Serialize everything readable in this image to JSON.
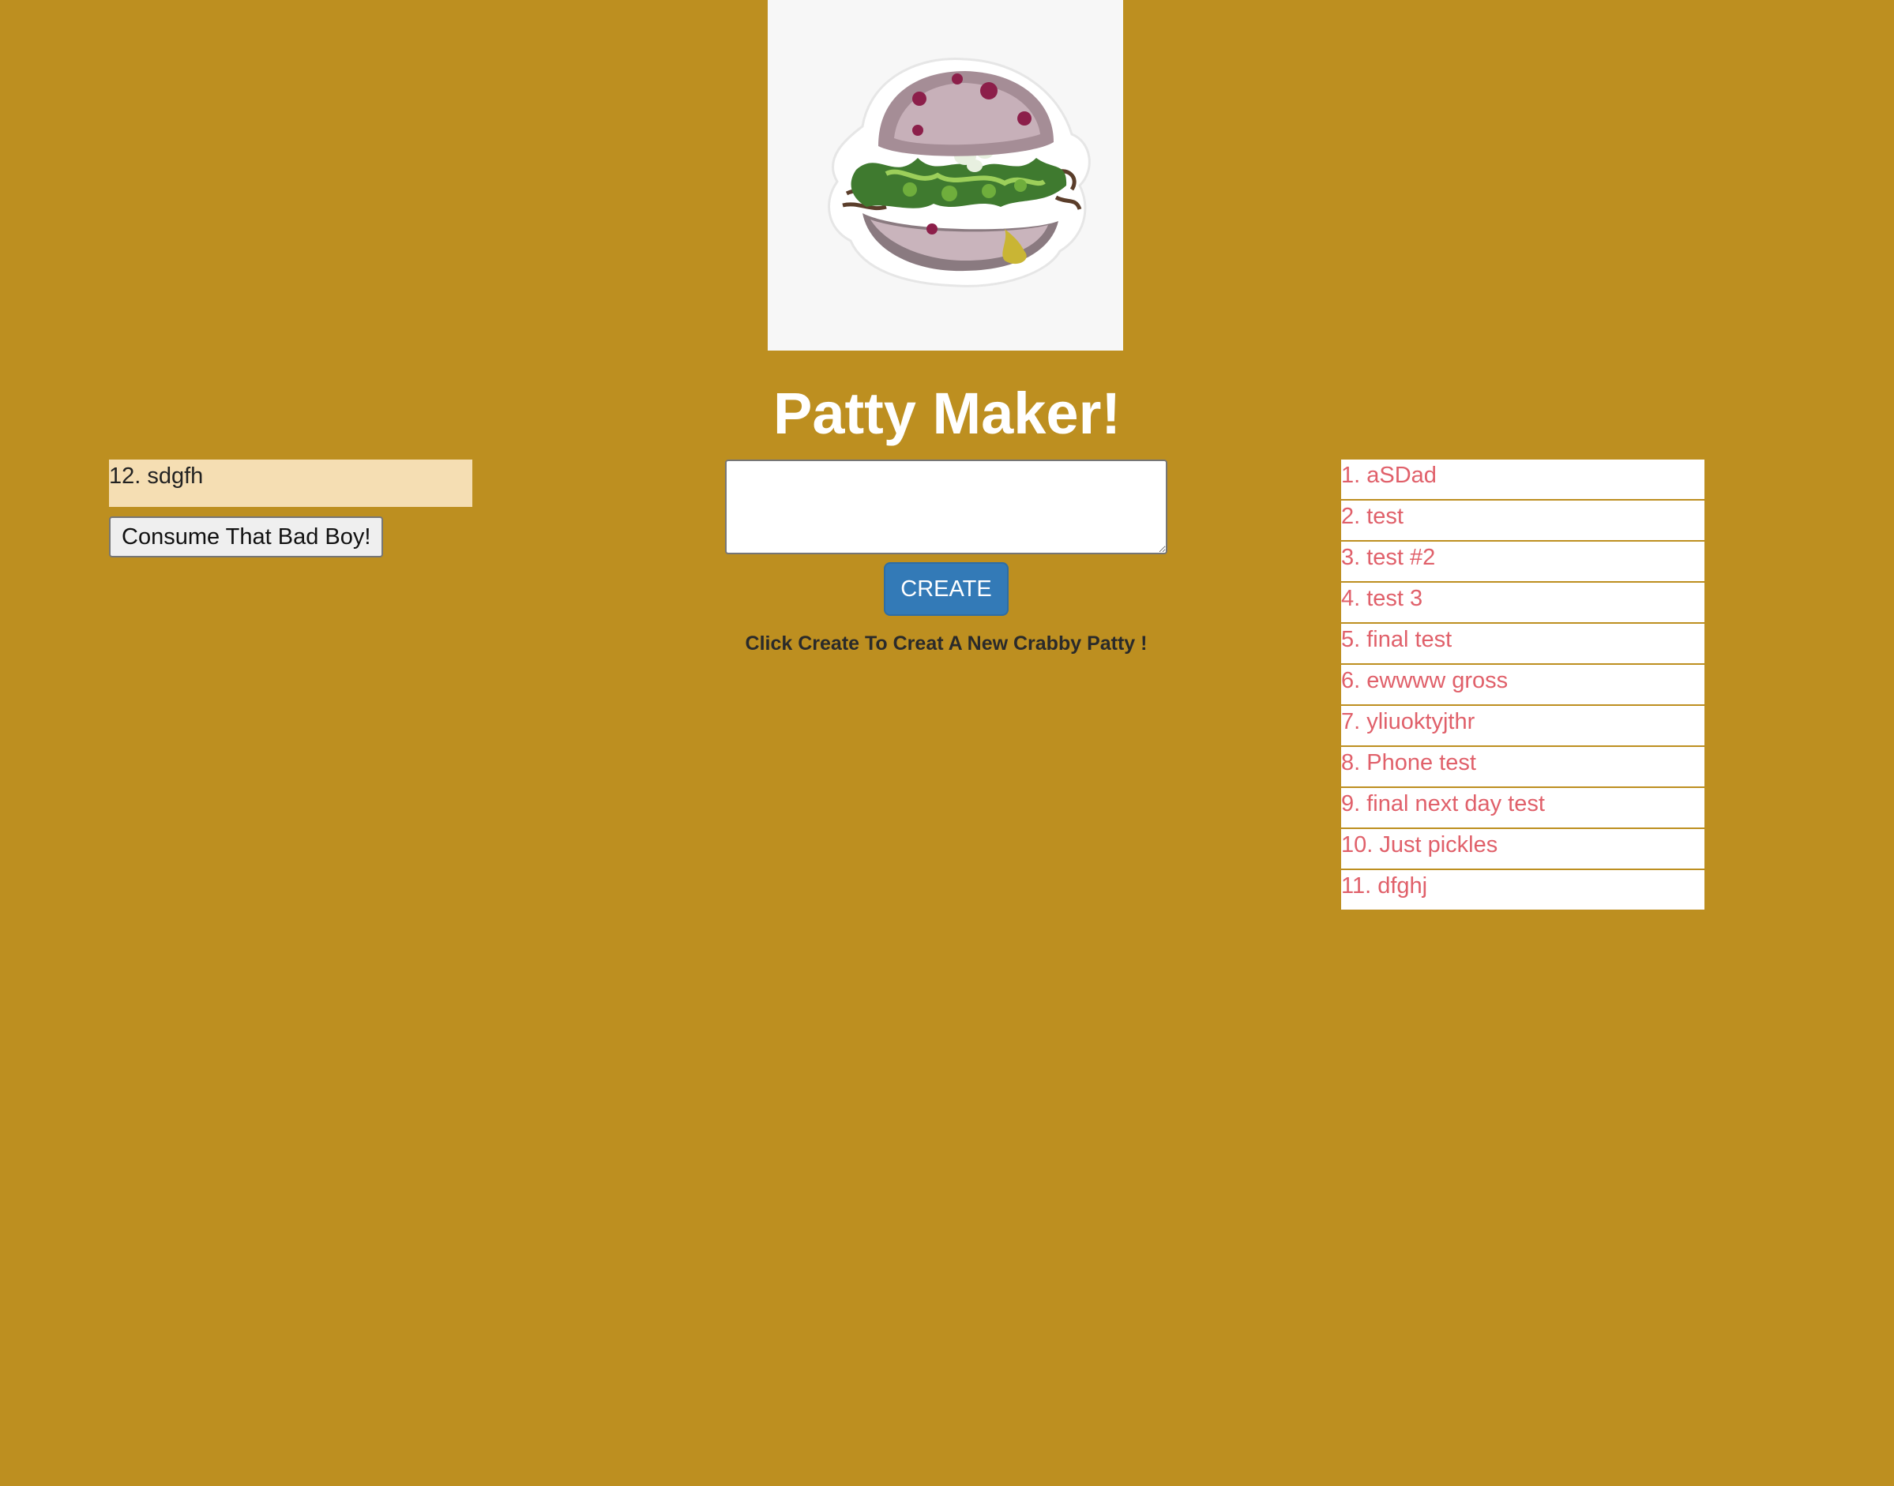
{
  "header": {
    "image_icon": "krabby-patty-burger-illustration",
    "title": "Patty Maker!"
  },
  "devoured": {
    "items": [
      {
        "label": "12. sdgfh"
      }
    ],
    "consume_button_label": "Consume That Bad Boy!"
  },
  "form": {
    "input_value": "",
    "create_button_label": "CREATE",
    "helper_text": "Click Create To Creat A New Crabby Patty !"
  },
  "burgers": {
    "items": [
      {
        "label": "1. aSDad"
      },
      {
        "label": "2. test"
      },
      {
        "label": "3. test #2"
      },
      {
        "label": "4. test 3"
      },
      {
        "label": "5. final test"
      },
      {
        "label": "6. ewwww gross"
      },
      {
        "label": "7. yliuoktyjthr"
      },
      {
        "label": "8. Phone test"
      },
      {
        "label": "9. final next day test"
      },
      {
        "label": "10. Just pickles"
      },
      {
        "label": "11. dfghj"
      }
    ]
  },
  "colors": {
    "page_background": "#BD8F20",
    "devoured_background": "#F5DEB3",
    "list_text": "#E0606A",
    "create_button": "#337AB7"
  }
}
